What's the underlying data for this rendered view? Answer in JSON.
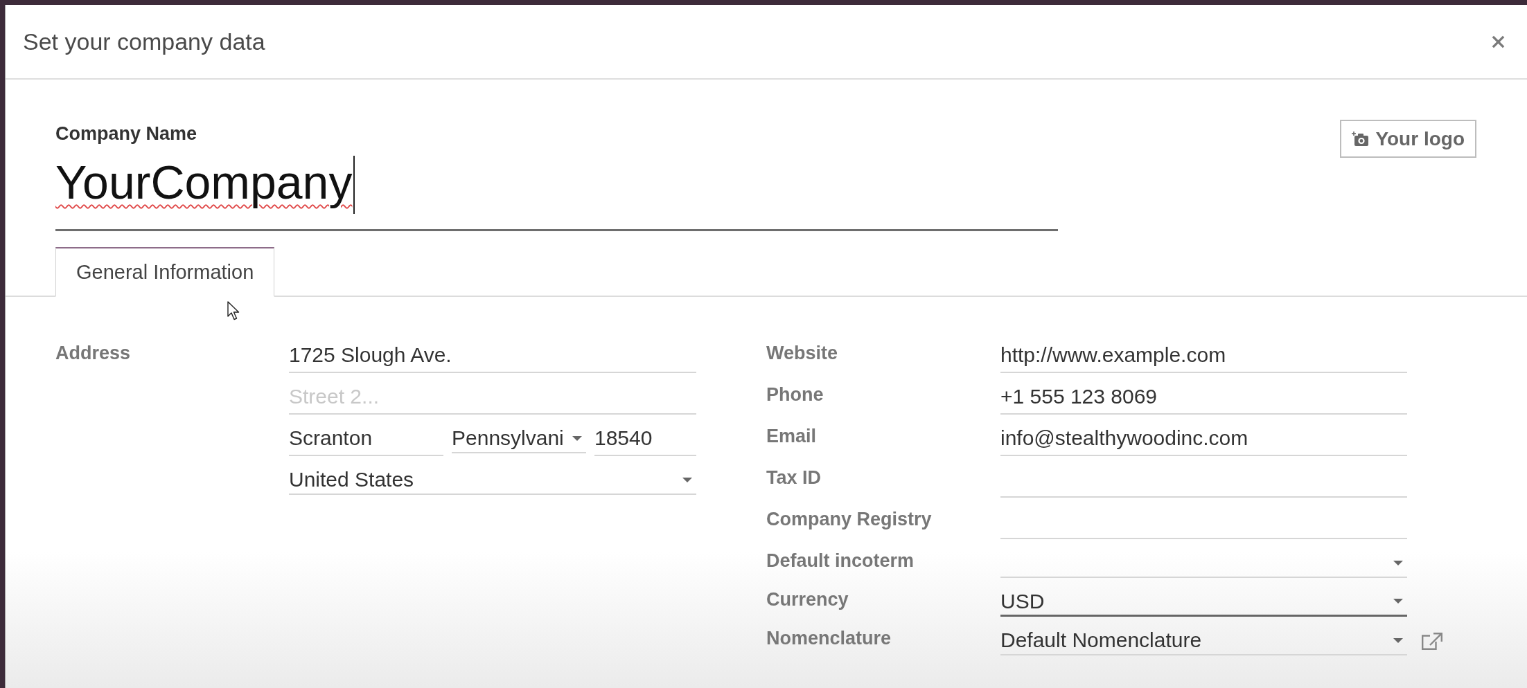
{
  "dialog": {
    "title": "Set your company data"
  },
  "company_name": {
    "label": "Company Name",
    "value": "YourCompany",
    "focused": true,
    "misspelled": true
  },
  "logo_button": {
    "label": "Your logo"
  },
  "tabs": [
    {
      "label": "General Information",
      "selected": true
    }
  ],
  "address": {
    "label": "Address",
    "rows": [
      {
        "fields": [
          {
            "kind": "text",
            "value": "1725 Slough Ave."
          }
        ]
      },
      {
        "fields": [
          {
            "kind": "text",
            "placeholder": "Street 2..."
          }
        ]
      },
      {
        "fields": [
          {
            "kind": "text",
            "value": "Scranton"
          },
          {
            "kind": "select",
            "value": "Pennsylvani"
          },
          {
            "kind": "text",
            "value": "18540"
          }
        ]
      },
      {
        "fields": [
          {
            "kind": "select",
            "value": "United States"
          }
        ]
      }
    ]
  },
  "details": [
    {
      "label": "Website",
      "kind": "text",
      "value": "http://www.example.com",
      "highlighted": false
    },
    {
      "label": "Phone",
      "kind": "text",
      "value": "+1 555 123 8069",
      "highlighted": false
    },
    {
      "label": "Email",
      "kind": "text",
      "value": "info@stealthywoodinc.com",
      "highlighted": false
    },
    {
      "label": "Tax ID",
      "kind": "text",
      "highlighted": false
    },
    {
      "label": "Company Registry",
      "kind": "text",
      "highlighted": false
    },
    {
      "label": "Default incoterm",
      "kind": "select",
      "highlighted": false
    },
    {
      "label": "Currency",
      "kind": "select",
      "value": "USD",
      "highlighted": true
    },
    {
      "label": "Nomenclature",
      "kind": "relation",
      "value": "Default Nomenclature",
      "highlighted": false
    }
  ]
}
